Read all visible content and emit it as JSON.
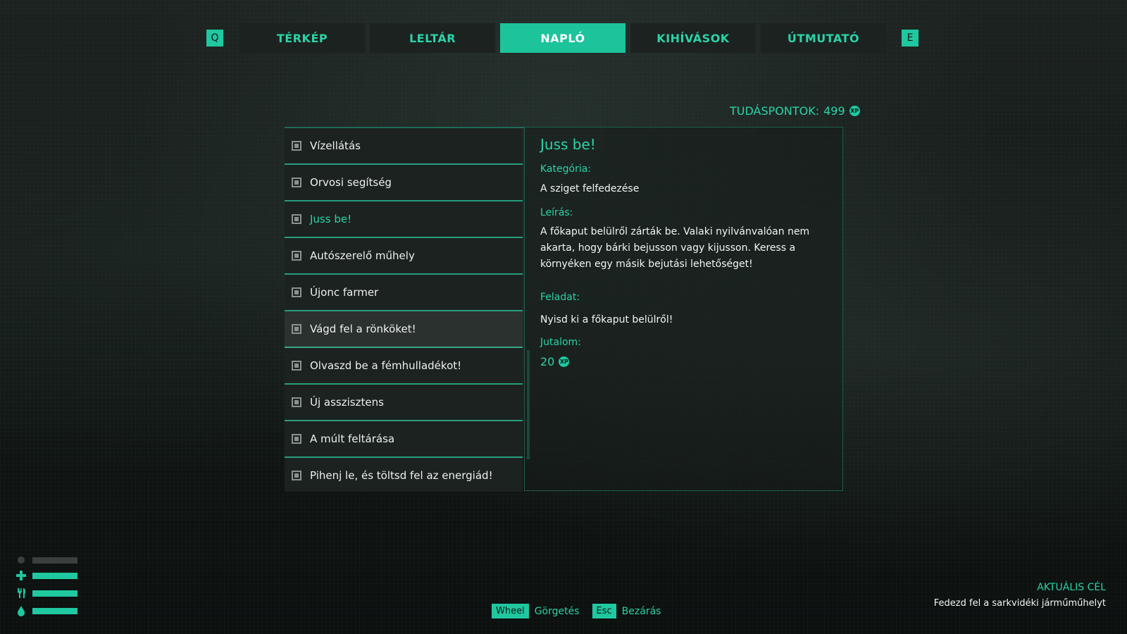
{
  "nav": {
    "prev_key": "Q",
    "next_key": "E",
    "tabs": [
      {
        "label": "TÉRKÉP"
      },
      {
        "label": "LELTÁR"
      },
      {
        "label": "NAPLÓ"
      },
      {
        "label": "KIHÍVÁSOK"
      },
      {
        "label": "ÚTMUTATÓ"
      }
    ],
    "active_tab": "NAPLÓ"
  },
  "points": {
    "label": "TUDÁSPONTOK:",
    "value": "499",
    "currency_icon": "xp-coin-icon"
  },
  "quests": {
    "items": [
      {
        "label": "Vízellátás"
      },
      {
        "label": "Orvosi segítség"
      },
      {
        "label": "Juss be!"
      },
      {
        "label": "Autószerelő műhely"
      },
      {
        "label": "Újonc farmer"
      },
      {
        "label": "Vágd fel a rönköket!"
      },
      {
        "label": "Olvaszd be a fémhulladékot!"
      },
      {
        "label": "Új asszisztens"
      },
      {
        "label": "A múlt feltárása"
      },
      {
        "label": "Pihenj le, és töltsd fel az energiád!"
      }
    ],
    "selected": "Juss be!",
    "hovered": "Vágd fel a rönköket!"
  },
  "detail": {
    "title": "Juss be!",
    "category_label": "Kategória:",
    "category": "A sziget felfedezése",
    "description_label": "Leírás:",
    "description": "A főkaput belülről zárták be. Valaki nyilvánvalóan nem akarta, hogy bárki bejusson vagy kijusson. Keress a környéken egy másik bejutási lehetőséget!",
    "task_label": "Feladat:",
    "task": "Nyisd ki a főkaput belülről!",
    "reward_label": "Jutalom:",
    "reward_value": "20",
    "reward_icon": "xp-coin-icon"
  },
  "hud": {
    "icons": [
      "health-cross-icon",
      "food-utensils-icon",
      "water-drop-icon"
    ]
  },
  "footer": {
    "hints": [
      {
        "key": "Wheel",
        "action": "Görgetés"
      },
      {
        "key": "Esc",
        "action": "Bezárás"
      }
    ]
  },
  "objective": {
    "title": "AKTUÁLIS CÉL",
    "text": "Fedezd fel a sarkvidéki járműműhelyt"
  },
  "colors": {
    "accent": "#1fc8a0",
    "panel": "#1c2220",
    "background": "#101514"
  }
}
